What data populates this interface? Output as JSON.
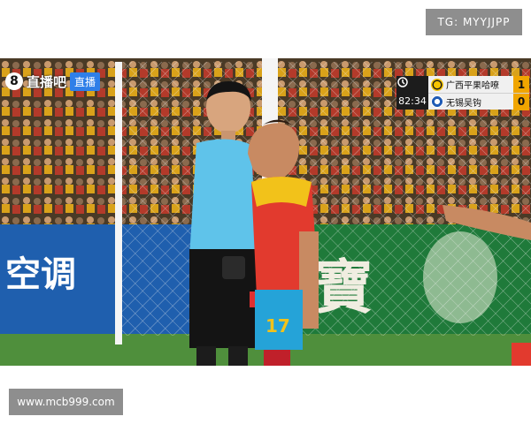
{
  "watermarks": {
    "top_right": "TG: MYYJJPP",
    "bottom_left": "www.mcb999.com"
  },
  "broadcast": {
    "logo_mark": "8",
    "logo_text": "直播吧",
    "live_badge": "直播"
  },
  "scoreboard": {
    "clock": "82:34",
    "home_team": "广西平果哈嘹",
    "home_score": "1",
    "away_team": "无锡吴钩",
    "away_score": "0",
    "score_color": "#f0a500"
  },
  "stadium_ad": {
    "left_text": "空调",
    "right_text": "寶"
  },
  "players": {
    "away_player_number": "17"
  },
  "colors": {
    "referee_shirt": "#5fc3ea",
    "player_shirt": "#e23a2e",
    "player_shorts": "#25a3d8",
    "pitch": "#4f8f3c",
    "ad_board_left": "#1f5fae",
    "ad_board_right": "#1f7a3a"
  }
}
